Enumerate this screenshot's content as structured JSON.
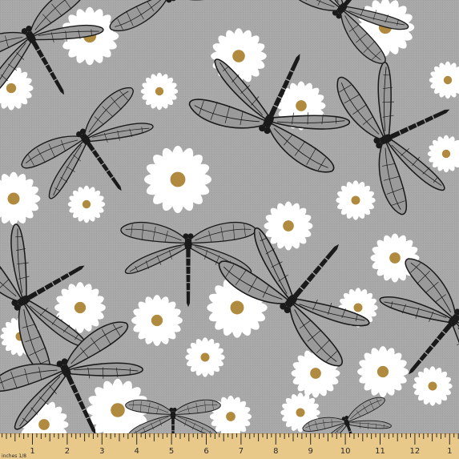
{
  "image": {
    "kind": "fabric swatch photo",
    "pattern_motifs": [
      "dragonfly",
      "daisy"
    ],
    "colors": {
      "background": "#a9a9a9",
      "dragonfly_ink": "#1a1a1a",
      "wing_fill": "#9a9a9a",
      "daisy_petal": "#ffffff",
      "daisy_center": "#b08a3e",
      "ruler": "#e9c98a",
      "ruler_ink": "#2a2a2a"
    }
  },
  "ruler": {
    "unit_label": "inches 1/8",
    "numbers": [
      "1",
      "2",
      "3",
      "4",
      "5",
      "6",
      "7",
      "8",
      "9",
      "10",
      "11",
      "12",
      "1"
    ]
  }
}
